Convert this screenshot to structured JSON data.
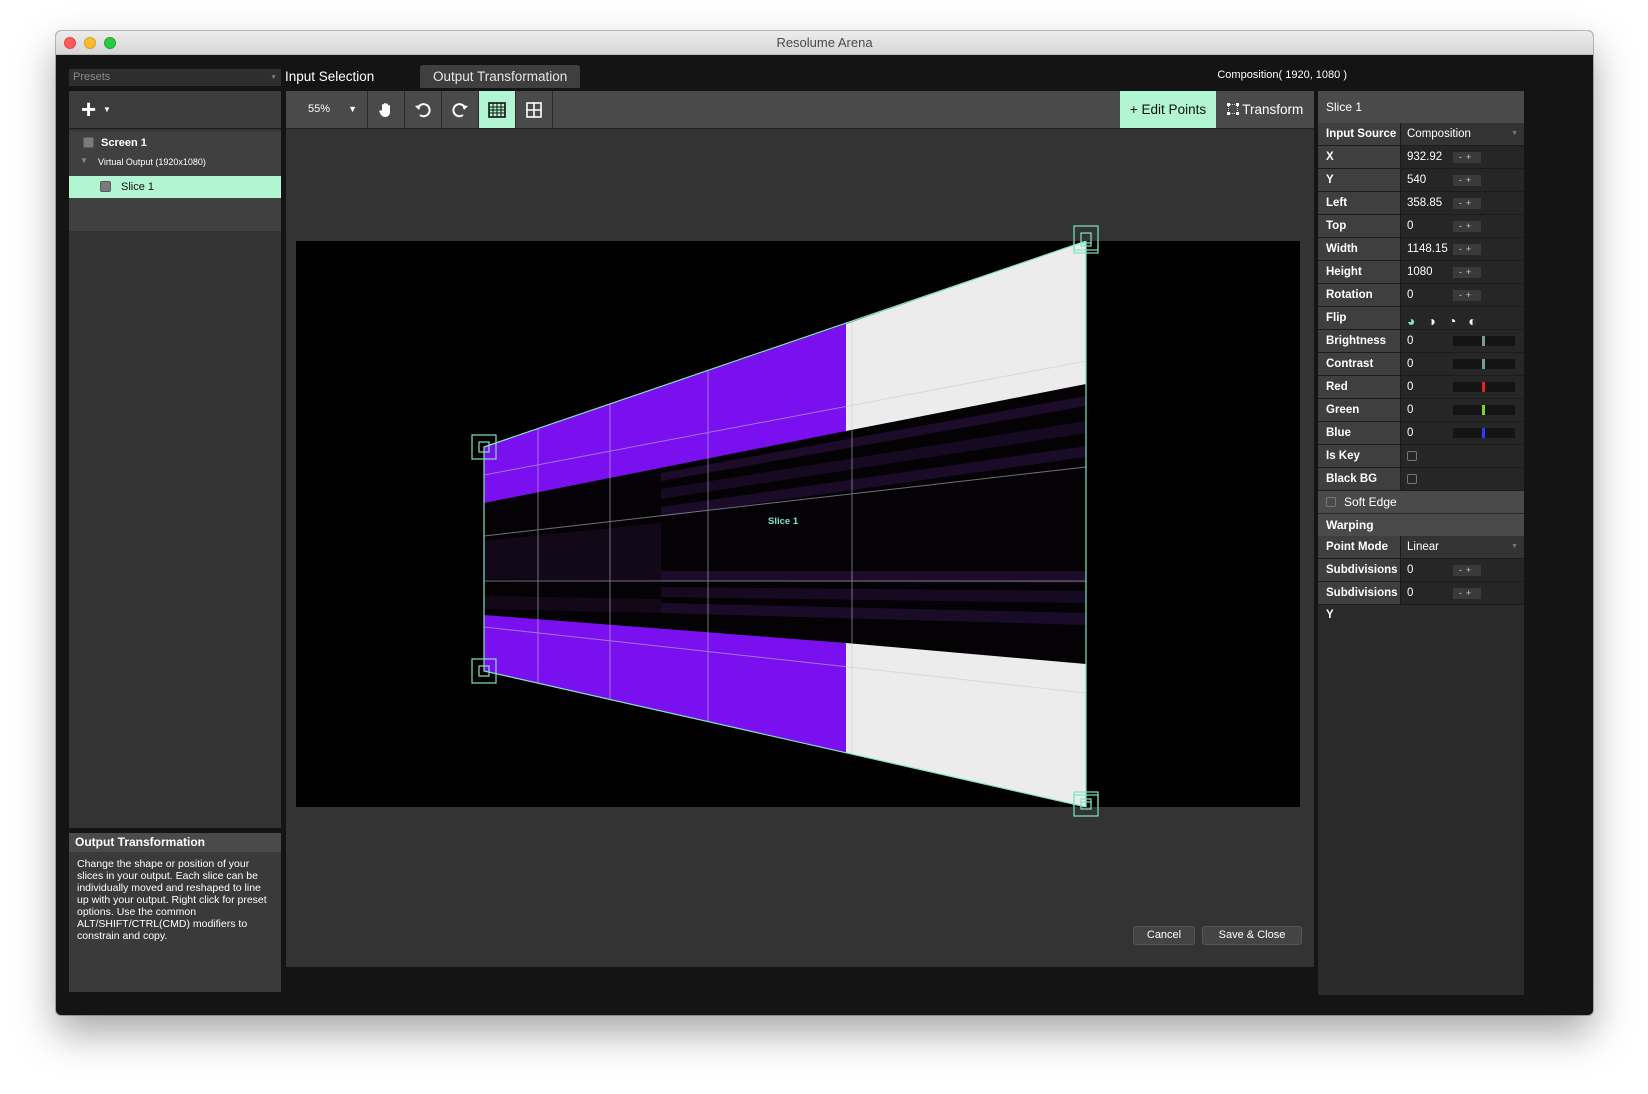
{
  "window": {
    "title": "Resolume Arena"
  },
  "presets": {
    "label": "Presets"
  },
  "tree": {
    "screen_label": "Screen 1",
    "virtual_output_label": "Virtual Output (1920x1080)",
    "slice_label": "Slice 1"
  },
  "info": {
    "title": "Output Transformation",
    "body": "Change the shape or position of your slices in your output. Each slice can be individually moved and reshaped to line up with your output. Right click for preset options. Use the common ALT/SHIFT/CTRL(CMD) modifiers to constrain and copy."
  },
  "tabs": [
    {
      "label": "Input Selection",
      "active": false
    },
    {
      "label": "Output Transformation",
      "active": true
    }
  ],
  "composition_label": "Composition( 1920, 1080 )",
  "toolbar": {
    "zoom": "55%",
    "edit_points": "Edit Points",
    "transform": "Transform"
  },
  "canvas": {
    "slice_label": "Slice 1"
  },
  "properties": {
    "title": "Slice 1",
    "input_source": {
      "label": "Input Source",
      "value": "Composition"
    },
    "rows": [
      {
        "label": "X",
        "value": "932.92"
      },
      {
        "label": "Y",
        "value": "540"
      },
      {
        "label": "Left",
        "value": "358.85"
      },
      {
        "label": "Top",
        "value": "0"
      },
      {
        "label": "Width",
        "value": "1148.15"
      },
      {
        "label": "Height",
        "value": "1080"
      },
      {
        "label": "Rotation",
        "value": "0"
      }
    ],
    "flip_label": "Flip",
    "color_rows": [
      {
        "label": "Brightness",
        "value": "0",
        "color": "#7a9a8a"
      },
      {
        "label": "Contrast",
        "value": "0",
        "color": "#7a9a8a"
      },
      {
        "label": "Red",
        "value": "0",
        "color": "#e02424"
      },
      {
        "label": "Green",
        "value": "0",
        "color": "#7fd323"
      },
      {
        "label": "Blue",
        "value": "0",
        "color": "#2a3cff"
      }
    ],
    "is_key": {
      "label": "Is Key"
    },
    "black_bg": {
      "label": "Black BG"
    },
    "soft_edge": "Soft Edge",
    "warping": "Warping",
    "point_mode": {
      "label": "Point Mode",
      "value": "Linear"
    },
    "subdivisions_x": {
      "label": "Subdivisions X",
      "value": "0"
    },
    "subdivisions_y": {
      "label": "Subdivisions Y",
      "value": "0"
    }
  },
  "buttons": {
    "cancel": "Cancel",
    "save_close": "Save & Close"
  },
  "colors": {
    "accent": "#b1f5d2",
    "purple": "#7a10f0"
  }
}
